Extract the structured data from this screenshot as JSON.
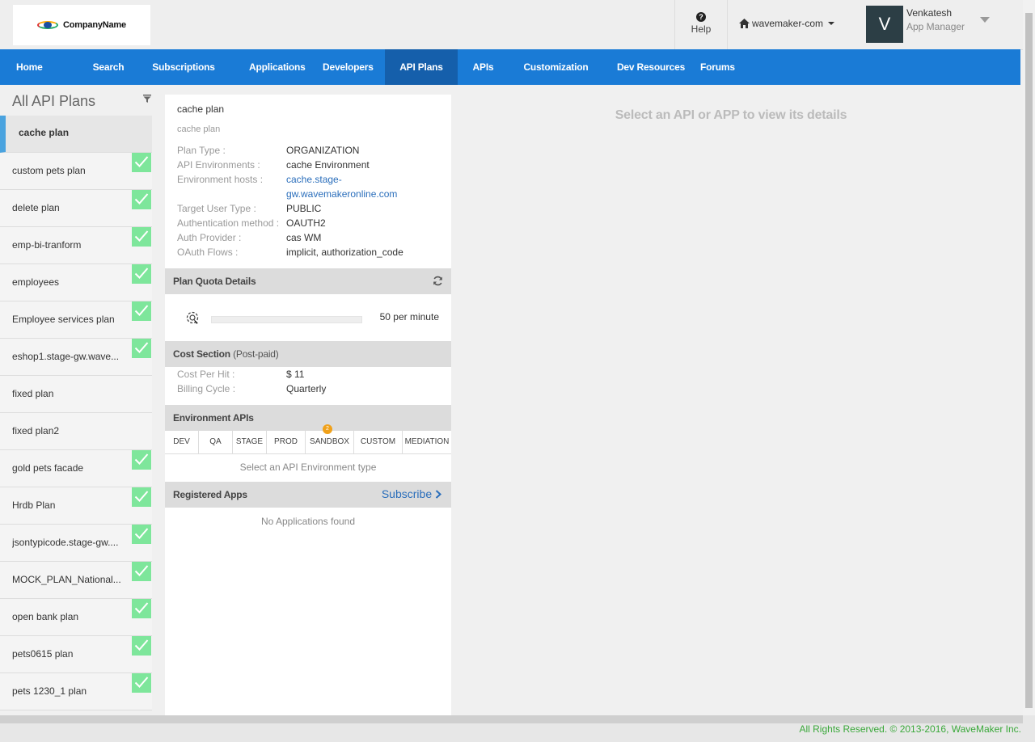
{
  "header": {
    "logo_text": "CompanyName",
    "help_label": "Help",
    "tenant": "wavemaker-com",
    "user": {
      "initial": "V",
      "name": "Venkatesh",
      "role": "App Manager"
    }
  },
  "nav": {
    "items": [
      {
        "label": "Home"
      },
      {
        "label": "Search"
      },
      {
        "label": "Subscriptions"
      },
      {
        "label": "Applications"
      },
      {
        "label": "Developers"
      },
      {
        "label": "API Plans",
        "active": true
      },
      {
        "label": "APIs"
      },
      {
        "label": "Customization"
      },
      {
        "label": "Dev Resources"
      },
      {
        "label": "Forums"
      }
    ]
  },
  "sidebar": {
    "title": "All API Plans",
    "plans": [
      {
        "label": "cache plan",
        "active": true,
        "checked": false
      },
      {
        "label": "custom pets plan",
        "checked": true
      },
      {
        "label": "delete plan",
        "checked": true
      },
      {
        "label": "emp-bi-tranform",
        "checked": true
      },
      {
        "label": "employees",
        "checked": true
      },
      {
        "label": "Employee services plan",
        "checked": true
      },
      {
        "label": "eshop1.stage-gw.wave...",
        "checked": true
      },
      {
        "label": "fixed plan",
        "checked": false
      },
      {
        "label": "fixed plan2",
        "checked": false
      },
      {
        "label": "gold pets facade",
        "checked": true
      },
      {
        "label": "Hrdb Plan",
        "checked": true
      },
      {
        "label": "jsontypicode.stage-gw....",
        "checked": true
      },
      {
        "label": "MOCK_PLAN_National...",
        "checked": true
      },
      {
        "label": "open bank plan",
        "checked": true
      },
      {
        "label": "pets0615 plan",
        "checked": true
      },
      {
        "label": "pets 1230_1 plan",
        "checked": true
      }
    ]
  },
  "detail": {
    "title": "cache plan",
    "subtitle": "cache plan",
    "fields": {
      "plan_type": {
        "k": "Plan Type :",
        "v": "ORGANIZATION"
      },
      "api_envs": {
        "k": "API Environments :",
        "v": "cache Environment"
      },
      "env_hosts": {
        "k": "Environment hosts :",
        "v1": "cache.stage-",
        "v2": "gw.wavemakeronline.com"
      },
      "target_user": {
        "k": "Target User Type :",
        "v": "PUBLIC"
      },
      "auth_method": {
        "k": "Authentication method :",
        "v": "OAUTH2"
      },
      "auth_provider": {
        "k": "Auth Provider :",
        "v": "cas WM"
      },
      "oauth_flows": {
        "k": "OAuth Flows :",
        "v": "implicit, authorization_code"
      }
    },
    "quota": {
      "title": "Plan Quota Details",
      "rate": "50 per minute"
    },
    "cost": {
      "title": "Cost Section",
      "subtitle": "(Post-paid)",
      "per_hit": {
        "k": "Cost Per Hit :",
        "v": "$ 11"
      },
      "billing": {
        "k": "Billing Cycle :",
        "v": "Quarterly"
      }
    },
    "env_apis": {
      "title": "Environment APIs",
      "tabs": [
        "DEV",
        "QA",
        "STAGE",
        "PROD",
        "SANDBOX",
        "CUSTOM",
        "MEDIATION"
      ],
      "sandbox_badge": "2",
      "empty": "Select an API Environment type"
    },
    "apps": {
      "title": "Registered Apps",
      "subscribe": "Subscribe",
      "empty": "No Applications found"
    }
  },
  "main": {
    "message": "Select an API or APP to view its details"
  },
  "footer": {
    "text": "All Rights Reserved. © 2013-2016, WaveMaker Inc."
  },
  "colors": {
    "nav": "#1a7bd6",
    "nav_active": "#155fab",
    "check": "#7ee69b",
    "link": "#2a6ebb",
    "footer_text": "#3aa83a"
  }
}
